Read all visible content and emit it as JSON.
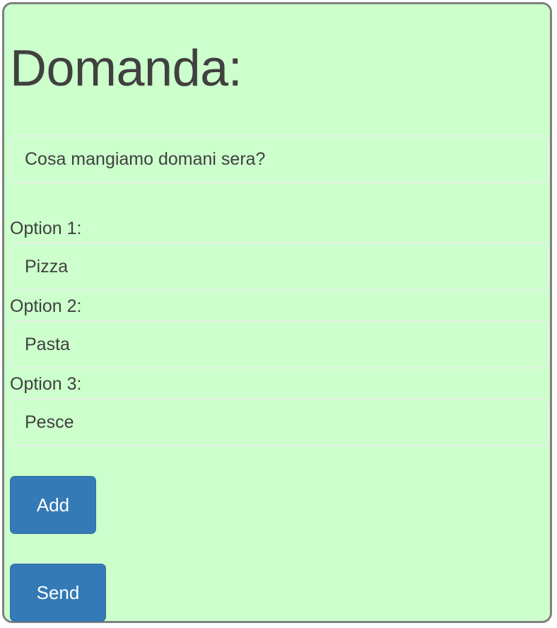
{
  "form": {
    "title": "Domanda:",
    "question_value": "Cosa mangiamo domani sera?",
    "options": [
      {
        "label": "Option 1:",
        "value": "Pizza"
      },
      {
        "label": "Option 2:",
        "value": "Pasta"
      },
      {
        "label": "Option 3:",
        "value": "Pesce"
      }
    ],
    "add_label": "Add",
    "send_label": "Send"
  },
  "colors": {
    "card_background": "#ccffcc",
    "card_border": "#808080",
    "text": "#404040",
    "button_primary": "#337ab7",
    "button_text": "#ffffff"
  }
}
